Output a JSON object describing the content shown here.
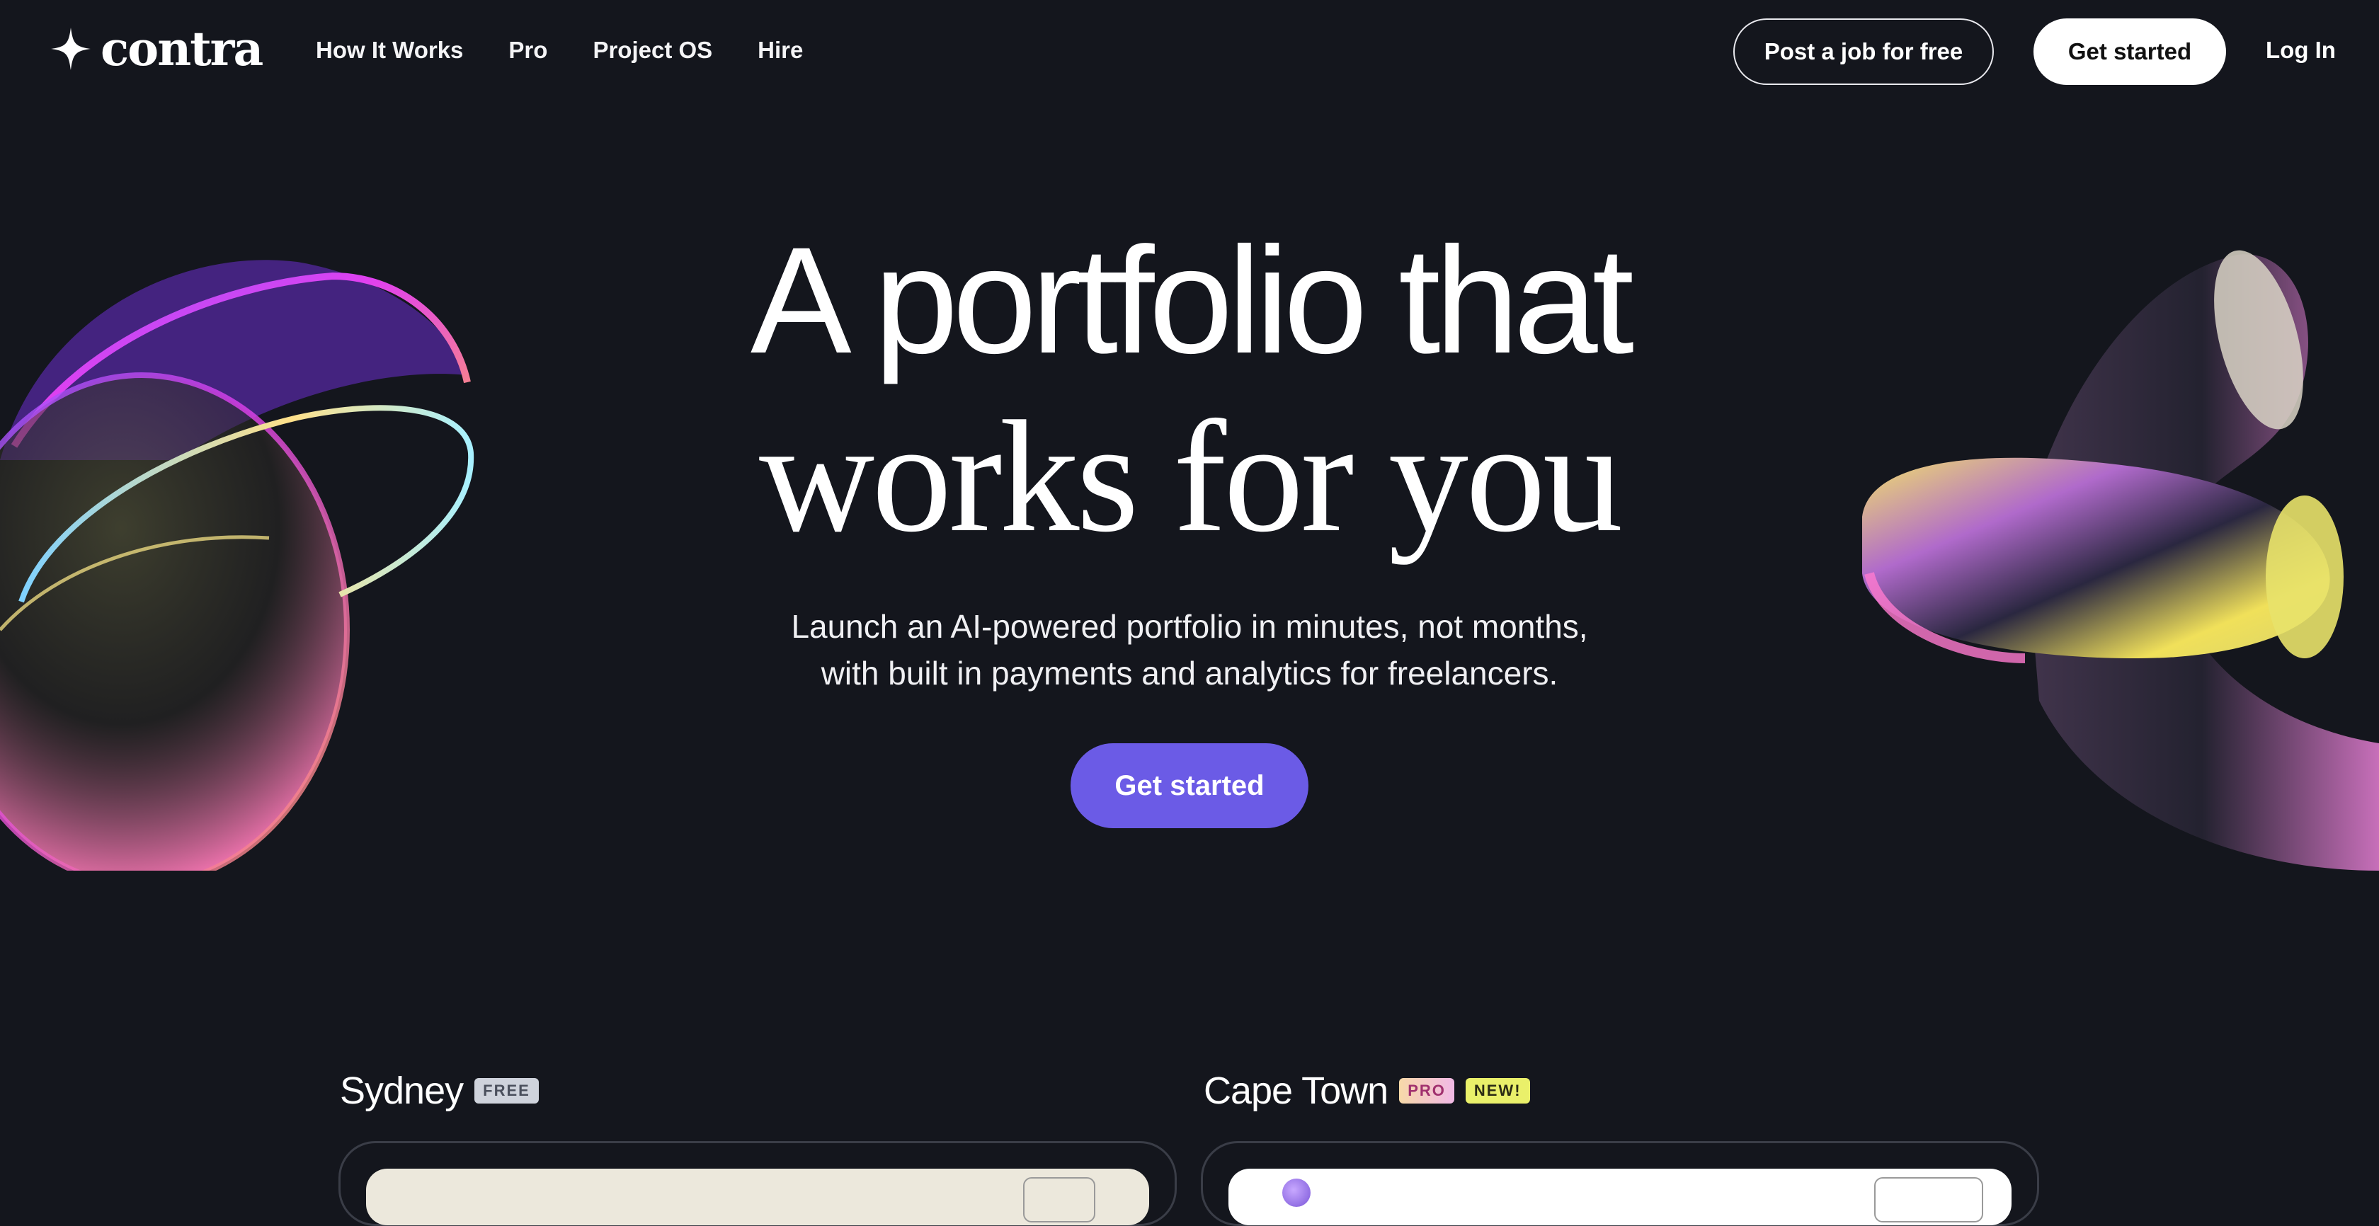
{
  "nav": {
    "logo_text": "contra",
    "links": [
      "How It Works",
      "Pro",
      "Project OS",
      "Hire"
    ],
    "post_job_label": "Post a job for free",
    "get_started_label": "Get started",
    "login_label": "Log In"
  },
  "hero": {
    "headline_line1": "A portfolio that",
    "headline_line2": "works for you",
    "subtitle_line1": "Launch an AI-powered portfolio in minutes, not months,",
    "subtitle_line2": "with built in payments and analytics for freelancers.",
    "cta_label": "Get started"
  },
  "templates": [
    {
      "name": "Sydney",
      "badges": [
        "FREE"
      ]
    },
    {
      "name": "Cape Town",
      "badges": [
        "PRO",
        "NEW!"
      ]
    }
  ],
  "colors": {
    "background": "#14161d",
    "cta": "#6b5be6",
    "text": "#ffffff"
  }
}
